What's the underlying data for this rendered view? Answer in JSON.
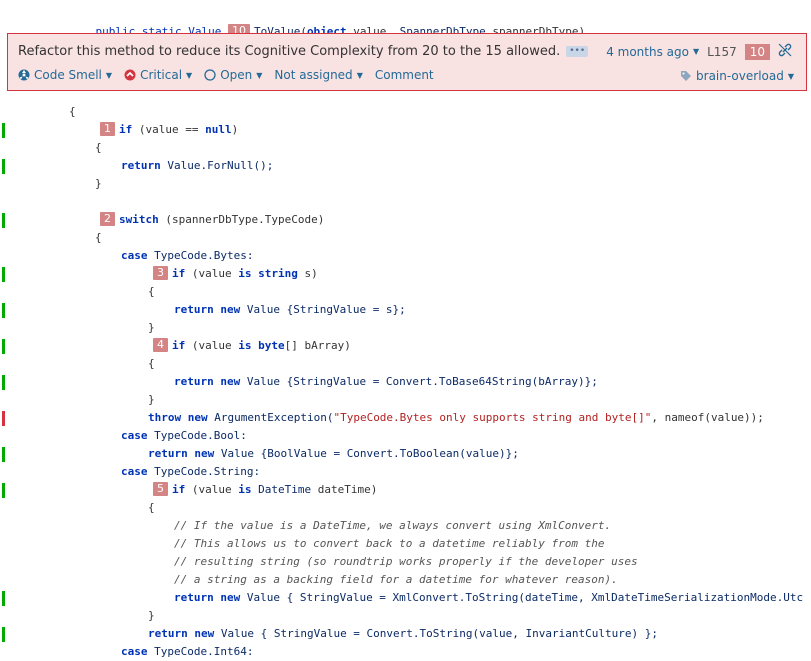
{
  "header_line": {
    "prefix": "public static Value ",
    "complexity": "10",
    "method_name": "ToValue",
    "params_open": "(",
    "kw_object": "object",
    "params_mid": " value, ",
    "param_type": "SpannerDbType",
    "params_end": " spannerDbType)"
  },
  "issue": {
    "message": "Refactor this method to reduce its Cognitive Complexity from 20 to the 15 allowed.",
    "more": "•••",
    "age": "4 months ago",
    "line_ref": "L157",
    "effort_badge": "10",
    "type": "Code Smell",
    "severity": "Critical",
    "status": "Open",
    "assignee": "Not assigned",
    "comment": "Comment",
    "tag": "brain-overload"
  },
  "code": {
    "l1": "{",
    "b1": "1",
    "l2a": "if",
    "l2b": " (value == ",
    "l2c": "null",
    "l2d": ")",
    "l3": "{",
    "l4a": "return ",
    "l4b": "Value.ForNull();",
    "l5": "}",
    "b2": "2",
    "l7a": "switch",
    "l7b": " (spannerDbType.TypeCode)",
    "l8": "{",
    "l9a": "case ",
    "l9b": "TypeCode.Bytes:",
    "b3": "3",
    "l10a": "if",
    "l10b": " (value ",
    "l10c": "is string",
    "l10d": " s)",
    "l11": "{",
    "l12a": "return new ",
    "l12b": "Value {StringValue = s};",
    "l13": "}",
    "b4": "4",
    "l14a": "if",
    "l14b": " (value ",
    "l14c": "is byte",
    "l14d": "[] bArray)",
    "l15": "{",
    "l16a": "return new ",
    "l16b": "Value {StringValue = Convert.ToBase64String(bArray)};",
    "l17": "}",
    "l18a": "throw new ",
    "l18b": "ArgumentException(",
    "l18c": "\"TypeCode.Bytes only supports string and byte[]\"",
    "l18d": ", nameof(value));",
    "l19a": "case ",
    "l19b": "TypeCode.Bool:",
    "l20a": "return new ",
    "l20b": "Value {BoolValue = Convert.ToBoolean(value)};",
    "l21a": "case ",
    "l21b": "TypeCode.String:",
    "b5": "5",
    "l22a": "if",
    "l22b": " (value ",
    "l22c": "is",
    "l22d": " DateTime",
    "l22e": " dateTime)",
    "l23": "{",
    "l24": "// If the value is a DateTime, we always convert using XmlConvert.",
    "l25": "// This allows us to convert back to a datetime reliably from the",
    "l26": "// resulting string (so roundtrip works properly if the developer uses",
    "l27": "// a string as a backing field for a datetime for whatever reason).",
    "l28a": "return new ",
    "l28b": "Value { StringValue = XmlConvert.ToString(dateTime, XmlDateTimeSerializationMode.Utc",
    "l29": "}",
    "l30a": "return new ",
    "l30b": "Value { StringValue = Convert.ToString(value, InvariantCulture) };",
    "l31a": "case ",
    "l31b": "TypeCode.Int64:"
  }
}
